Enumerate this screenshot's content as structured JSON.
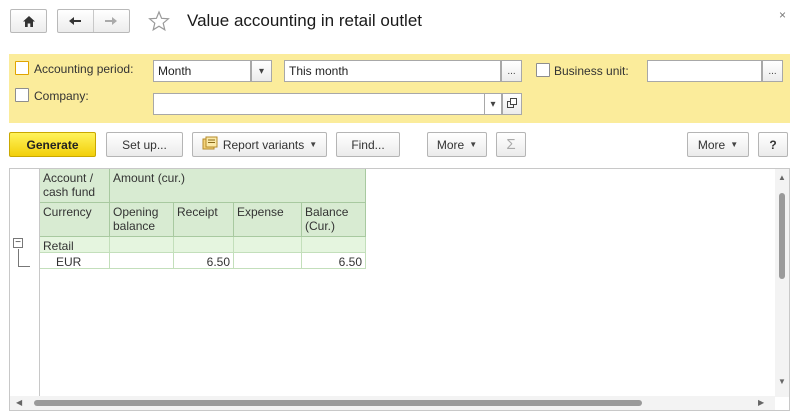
{
  "window": {
    "title": "Value accounting in retail outlet",
    "close_glyph": "×"
  },
  "nav": {
    "home_icon": "home-icon",
    "back_icon": "arrow-left-icon",
    "forward_icon": "arrow-right-icon",
    "favorite_icon": "star-icon"
  },
  "filters": {
    "accounting_period_label": "Accounting period:",
    "period_type_value": "Month",
    "period_value": "This month",
    "business_unit_label": "Business unit:",
    "business_unit_value": "",
    "company_label": "Company:",
    "company_value": "",
    "ellipsis": "...",
    "dropdown_glyph": "▾"
  },
  "toolbar": {
    "generate": "Generate",
    "setup": "Set up...",
    "report_variants": "Report variants",
    "find": "Find...",
    "more_left": "More",
    "sum_glyph": "Σ",
    "more_right": "More",
    "help": "?"
  },
  "report": {
    "header": {
      "account": "Account / cash fund",
      "amount": "Amount (cur.)",
      "currency": "Currency",
      "opening_balance": "Opening balance",
      "receipt": "Receipt",
      "expense": "Expense",
      "balance": "Balance (Cur.)"
    },
    "group": {
      "label": "Retail",
      "collapse_glyph": "−"
    },
    "rows": [
      {
        "currency": "EUR",
        "opening_balance": "",
        "receipt": "6.50",
        "expense": "",
        "balance": "6.50"
      }
    ]
  },
  "colors": {
    "filter_panel": "#fbec9b",
    "generate_button": "#f7dc1e",
    "header_bg": "#d8ebd2",
    "group_bg": "#e5f5df"
  }
}
